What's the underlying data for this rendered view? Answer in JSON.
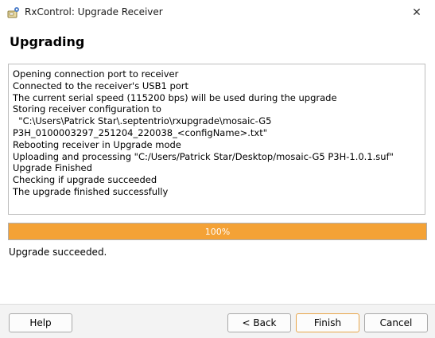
{
  "window": {
    "title": "RxControl: Upgrade Receiver",
    "close_symbol": "✕"
  },
  "main": {
    "heading": "Upgrading",
    "log_lines": [
      "Opening connection port to receiver",
      "Connected to the receiver's USB1 port",
      "The current serial speed (115200 bps) will be used during the upgrade",
      "Storing receiver configuration to",
      "  \"C:\\Users\\Patrick Star\\.septentrio\\rxupgrade\\mosaic-G5",
      "P3H_0100003297_251204_220038_<configName>.txt\"",
      "Rebooting receiver in Upgrade mode",
      "Uploading and processing \"C:/Users/Patrick Star/Desktop/mosaic-G5 P3H-1.0.1.suf\"",
      "Upgrade Finished",
      "Checking if upgrade succeeded",
      "The upgrade finished successfully"
    ],
    "progress": {
      "percent": 100,
      "label": "100%",
      "color": "#f4a236"
    },
    "status": "Upgrade succeeded."
  },
  "footer": {
    "help_label": "Help",
    "back_label": "< Back",
    "finish_label": "Finish",
    "cancel_label": "Cancel"
  }
}
